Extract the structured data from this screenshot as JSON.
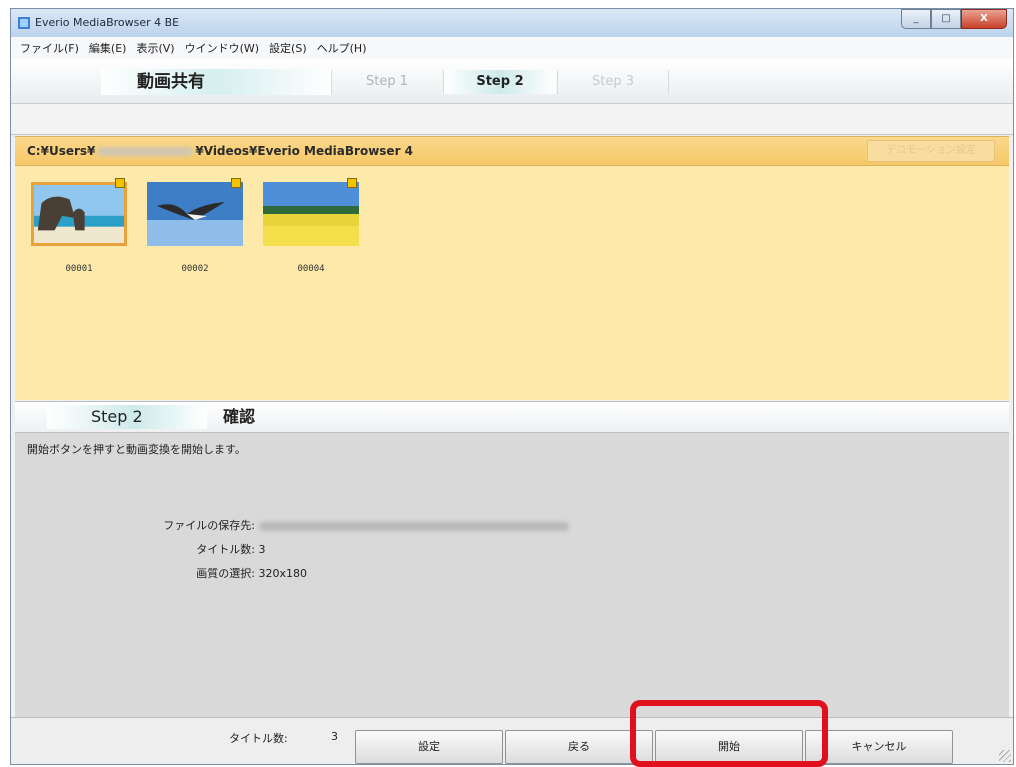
{
  "window": {
    "title": "Everio MediaBrowser 4 BE",
    "controls": [
      "_",
      "□",
      "X"
    ]
  },
  "menu": [
    "ファイル(F)",
    "編集(E)",
    "表示(V)",
    "ウインドウ(W)",
    "設定(S)",
    "ヘルプ(H)"
  ],
  "steps": {
    "mode_title": "動画共有",
    "step1": "Step 1",
    "step2": "Step 2",
    "step3": "Step 3"
  },
  "path": {
    "prefix": "C:¥Users¥",
    "suffix": "¥Videos¥Everio MediaBrowser 4",
    "deco_button": "デコモーション設定"
  },
  "thumbnails": [
    {
      "label": "00001",
      "icon": "beach-rock-thumbnail",
      "selected": true
    },
    {
      "label": "00002",
      "icon": "seagull-thumbnail",
      "selected": false
    },
    {
      "label": "00004",
      "icon": "flower-field-thumbnail",
      "selected": false
    }
  ],
  "section": {
    "step": "Step 2",
    "title": "確認"
  },
  "info": {
    "instruction": "開始ボタンを押すと動画変換を開始します。",
    "save_location_label": "ファイルの保存先:",
    "title_count_label": "タイトル数:",
    "title_count_value": "3",
    "quality_label": "画質の選択:",
    "quality_value": "320x180"
  },
  "footer": {
    "count_label": "タイトル数:",
    "count_value": "3",
    "settings_button": "設定",
    "back_button": "戻る",
    "start_button": "開始",
    "cancel_button": "キャンセル"
  },
  "colors": {
    "highlight": "#e0101c",
    "path_bar": "#f6c867",
    "thumb_area": "#fde9a9"
  }
}
